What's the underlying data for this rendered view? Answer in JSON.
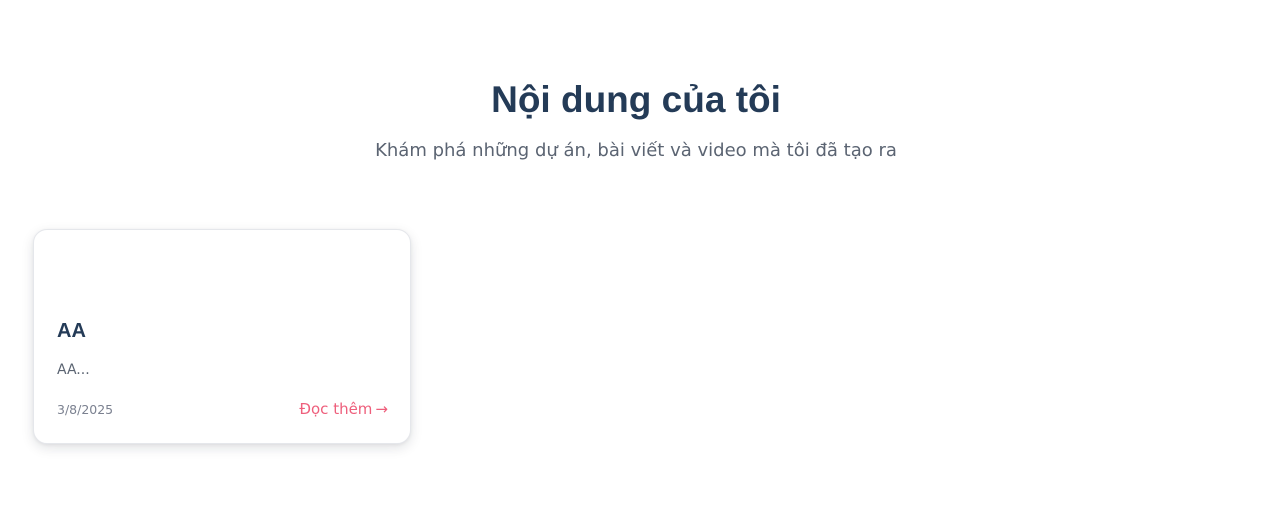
{
  "header": {
    "title": "Nội dung của tôi",
    "subtitle": "Khám phá những dự án, bài viết và video mà tôi đã tạo ra"
  },
  "cards": [
    {
      "title": "AA",
      "excerpt": "AA...",
      "date": "3/8/2025",
      "link_label": "Đọc thêm",
      "link_icon": "→"
    }
  ],
  "colors": {
    "title": "#243b57",
    "text": "#5b6472",
    "accent": "#ee5f7c",
    "border": "#e5e7eb"
  }
}
